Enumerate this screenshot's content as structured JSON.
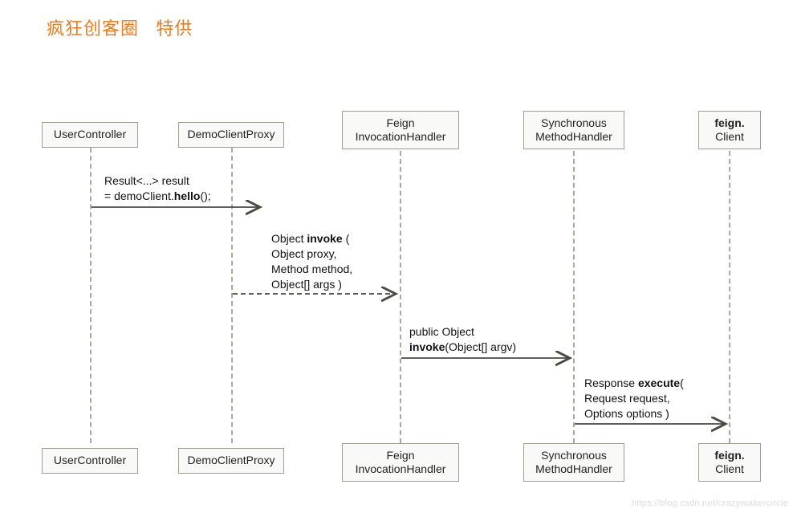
{
  "title_main": "疯狂创客圈",
  "title_second": "特供",
  "lifelines": {
    "l1": {
      "name": "UserController"
    },
    "l2": {
      "name": "DemoClientProxy"
    },
    "l3": {
      "name_line1": "Feign",
      "name_line2": "InvocationHandler"
    },
    "l4": {
      "name_line1": "Synchronous",
      "name_line2": "MethodHandler"
    },
    "l5": {
      "name_line1": "feign.",
      "name_line2": "Client"
    }
  },
  "messages": {
    "m1": {
      "line1_pre": "Result<...> result",
      "line2_pre": "= demoClient.",
      "line2_bold": "hello",
      "line2_post": "();"
    },
    "m2": {
      "l1_pre": "Object ",
      "l1_bold": "invoke",
      "l1_post": " (",
      "l2": "Object proxy,",
      "l3": " Method method,",
      "l4": " Object[] args    )"
    },
    "m3": {
      "l1": "public Object",
      "l2_bold": "invoke",
      "l2_post": "(Object[] argv)"
    },
    "m4": {
      "l1_pre": "Response ",
      "l1_bold": "execute",
      "l1_post": "(",
      "l2": "  Request request,",
      "l3": "  Options options )"
    }
  },
  "watermark": "https://blog.csdn.net/crazymakercircle",
  "chart_data": {
    "type": "sequence-diagram",
    "title": "疯狂创客圈 特供",
    "participants": [
      "UserController",
      "DemoClientProxy",
      "Feign InvocationHandler",
      "Synchronous MethodHandler",
      "feign.Client"
    ],
    "messages": [
      {
        "from": "UserController",
        "to": "DemoClientProxy",
        "label": "Result<...> result = demoClient.hello();",
        "style": "solid"
      },
      {
        "from": "DemoClientProxy",
        "to": "Feign InvocationHandler",
        "label": "Object invoke (Object proxy, Method method, Object[] args)",
        "style": "dashed"
      },
      {
        "from": "Feign InvocationHandler",
        "to": "Synchronous MethodHandler",
        "label": "public Object invoke(Object[] argv)",
        "style": "solid"
      },
      {
        "from": "Synchronous MethodHandler",
        "to": "feign.Client",
        "label": "Response execute(Request request, Options options)",
        "style": "solid"
      }
    ]
  }
}
